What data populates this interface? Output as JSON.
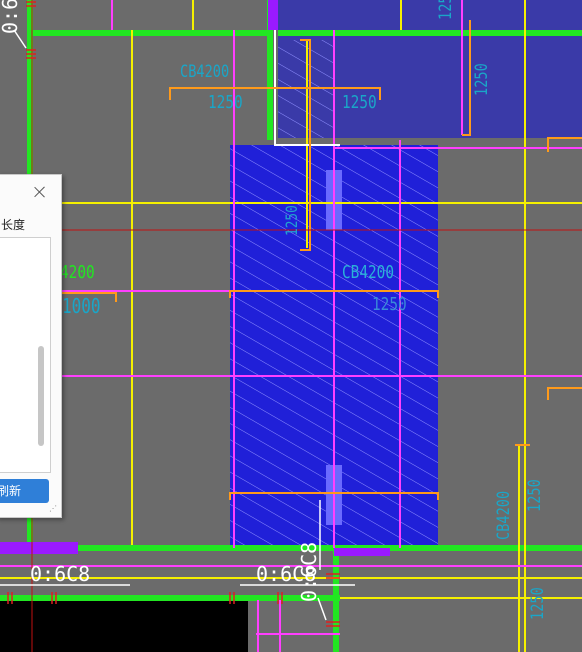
{
  "drawing": {
    "labels": {
      "beam_top": "CB4200",
      "beam_top_width": "1250",
      "beam_top_right_width": "1250",
      "beam_center": "CB4200",
      "beam_center_width": "1250",
      "left_beam": "4200",
      "left_beam_width": "1000",
      "right_beam": "CB4200",
      "right_beam_width": "1250",
      "right_small": "1250",
      "top_right_small": "1250",
      "top_corner_small": "1250",
      "bottom_right_small": "1250",
      "elevation_left": "0:6C8",
      "elevation_right": "0:6C8",
      "elevation_vertical": "0:6C8",
      "top_left_vertical": "0:6"
    }
  },
  "dialog": {
    "label": "长度",
    "refresh_button": "刷新"
  }
}
